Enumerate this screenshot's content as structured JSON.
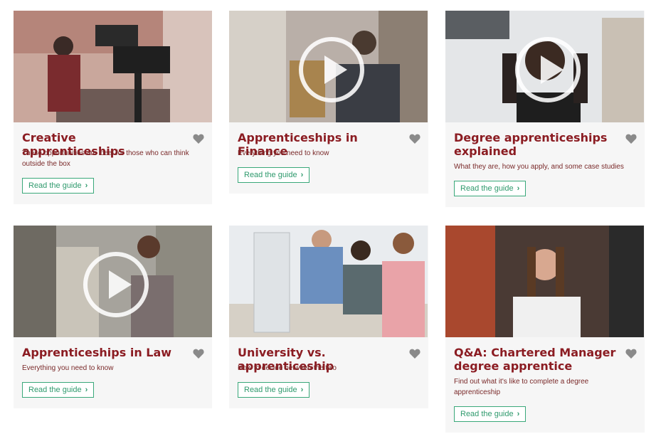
{
  "cards": [
    {
      "title": "Creative apprenticeships",
      "description": "These opportunities are ideal for those who can think outside the box",
      "button": "Read the guide",
      "chevron": "›",
      "has_video": false,
      "favorite_icon": "heart-icon"
    },
    {
      "title": "Apprenticeships in Finance",
      "description": "Everything you need to know",
      "button": "Read the guide",
      "chevron": "›",
      "has_video": true,
      "favorite_icon": "heart-icon"
    },
    {
      "title": "Degree apprenticeships explained",
      "description": "What they are, how you apply, and some case studies",
      "button": "Read the guide",
      "chevron": "›",
      "has_video": true,
      "favorite_icon": "heart-icon"
    },
    {
      "title": "Apprenticeships in Law",
      "description": "Everything you need to know",
      "button": "Read the guide",
      "chevron": "›",
      "has_video": true,
      "favorite_icon": "heart-icon"
    },
    {
      "title": "University vs. apprenticeship",
      "description": "How to decide between the two",
      "button": "Read the guide",
      "chevron": "›",
      "has_video": false,
      "favorite_icon": "heart-icon"
    },
    {
      "title": "Q&A: Chartered Manager degree apprentice",
      "description": "Find out what it's like to complete a degree apprenticeship",
      "button": "Read the guide",
      "chevron": "›",
      "has_video": false,
      "favorite_icon": "heart-icon"
    }
  ],
  "colors": {
    "title": "#8b1c22",
    "button_border": "#3aa87a",
    "heart": "#8a8a8a",
    "card_bg": "#f6f6f6"
  }
}
